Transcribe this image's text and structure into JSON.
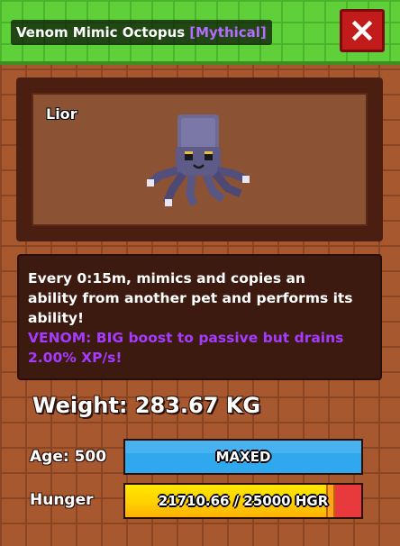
{
  "header": {
    "pet_title": "Venom Mimic Octopus",
    "rarity": "[Mythical]",
    "close_label": "X"
  },
  "viewer": {
    "pet_name": "Lior"
  },
  "description": {
    "line1": "Every 0:15m, mimics and copies an",
    "line2": "ability from another pet and performs its",
    "line3": "ability!",
    "venom1": "VENOM: BIG boost to passive but drains",
    "venom2": "2.00% XP/s!"
  },
  "stats": {
    "weight": "Weight: 283.67 KG",
    "age_label": "Age: 500",
    "age_bar_text": "MAXED",
    "age_fraction": 1.0,
    "hunger_label": "Hunger",
    "hunger_text": "21710.66 / 25000 HGR",
    "hunger_current": 21710.66,
    "hunger_max": 25000
  },
  "colors": {
    "rarity": "#b56bff",
    "venom_text": "#a43bff",
    "age_bar": "#2fa8ee",
    "hunger_fill": "#ffd000",
    "hunger_empty": "#e8393d",
    "close_button": "#c21b1b"
  },
  "icons": {
    "close": "close-icon",
    "pet": "octopus-pet-model"
  }
}
